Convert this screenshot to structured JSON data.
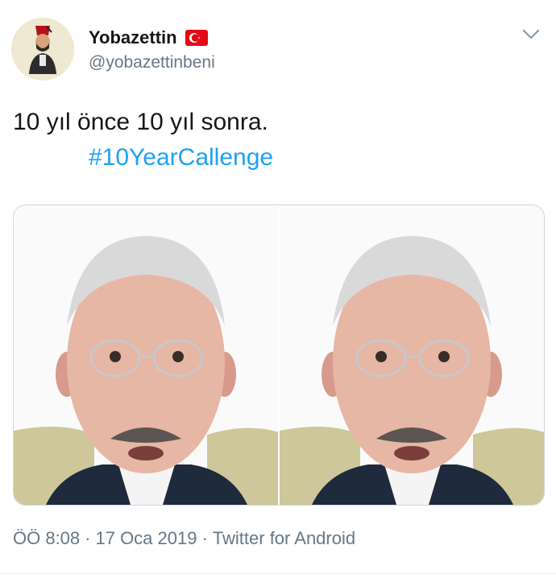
{
  "tweet": {
    "display_name": "Yobazettin",
    "handle": "@yobazettinbeni",
    "text": "10 yıl önce 10 yıl sonra.",
    "hashtag": "#10YearCallenge",
    "time": "ÖÖ 8:08",
    "date": "17 Oca 2019",
    "source": "Twitter for Android",
    "separator": "·"
  },
  "icons": {
    "flag": "turkey-flag-icon",
    "menu": "chevron-down-icon"
  },
  "colors": {
    "link": "#1da1f2",
    "secondary_text": "#657786",
    "flag_red": "#e30a17"
  }
}
